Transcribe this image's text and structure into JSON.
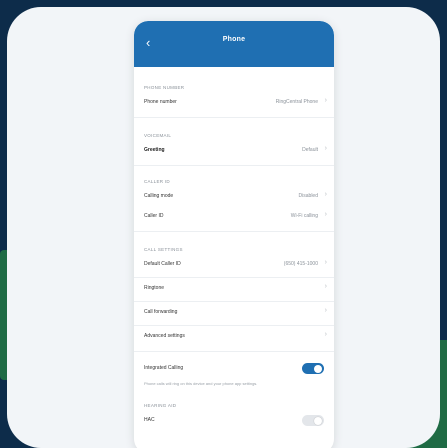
{
  "colors": {
    "accent": "#1f6fb2",
    "background": "#0d2c4a",
    "card": "#f2f5f8"
  },
  "nav": {
    "back_icon": "chevron-left-icon",
    "back_glyph": "‹",
    "title": "Phone"
  },
  "sections": {
    "number": "PHONE NUMBER",
    "my_number_row": {
      "label": "Phone number",
      "value": "Ring​Central Phone",
      "chevron": "›"
    },
    "voicemail": "VOICEMAIL",
    "greeting_row": {
      "label": "Greeting",
      "value": "Default",
      "chevron": "›"
    },
    "caller_id": "CALLER ID",
    "calling_mode_row": {
      "label": "Calling mode",
      "value": "Disabled",
      "chevron": "›"
    },
    "caller_id_row": {
      "label": "Caller ID",
      "value": "Wi-Fi calling",
      "chevron": "›"
    },
    "call_settings": "CALL SETTINGS",
    "default_caller_row": {
      "label": "Default Caller ID",
      "value": "(650) 415-1000",
      "chevron": "›"
    },
    "ringtone_row": {
      "label": "Ringtone",
      "chevron": "›"
    },
    "call_forwarding_row": {
      "label": "Call forwarding",
      "chevron": "›"
    },
    "advanced_row": {
      "label": "Advanced settings",
      "chevron": "›"
    },
    "integrated_row": {
      "label": "Integrated Calling",
      "state": "on"
    },
    "integrated_note": "Phone calls will ring on this device and your phone app settings.",
    "hearing_aid": "HEARING AID",
    "hac_row": {
      "label": "HAC",
      "state": "off"
    }
  }
}
